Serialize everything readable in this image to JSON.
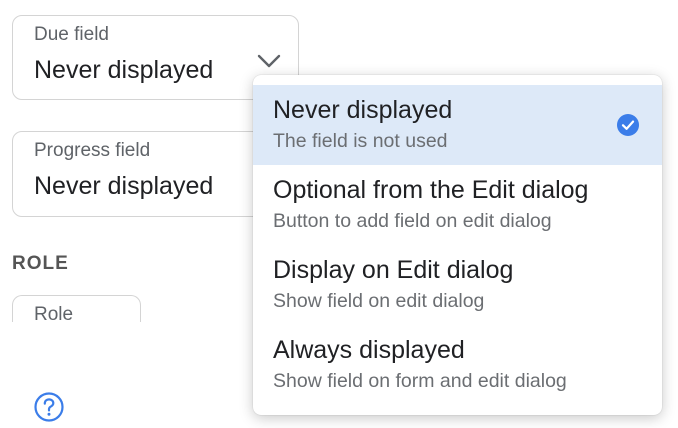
{
  "due_field": {
    "label": "Due field",
    "value": "Never displayed"
  },
  "progress_field": {
    "label": "Progress field",
    "value": "Never displayed"
  },
  "role_section": {
    "heading": "ROLE",
    "role_field_label": "Role"
  },
  "dropdown": {
    "options": [
      {
        "title": "Never displayed",
        "description": "The field is not used",
        "selected": true
      },
      {
        "title": "Optional from the Edit dialog",
        "description": "Button to add field on edit dialog",
        "selected": false
      },
      {
        "title": "Display on Edit dialog",
        "description": "Show field on edit dialog",
        "selected": false
      },
      {
        "title": "Always displayed",
        "description": "Show field on form and edit dialog",
        "selected": false
      }
    ]
  },
  "icons": {
    "chevron": "chevron-down-icon",
    "check": "check-circle-icon",
    "help": "help-circle-icon"
  },
  "colors": {
    "accent": "#3b7de9",
    "selected_bg": "#dde9f8",
    "border": "#d4d4d4"
  }
}
